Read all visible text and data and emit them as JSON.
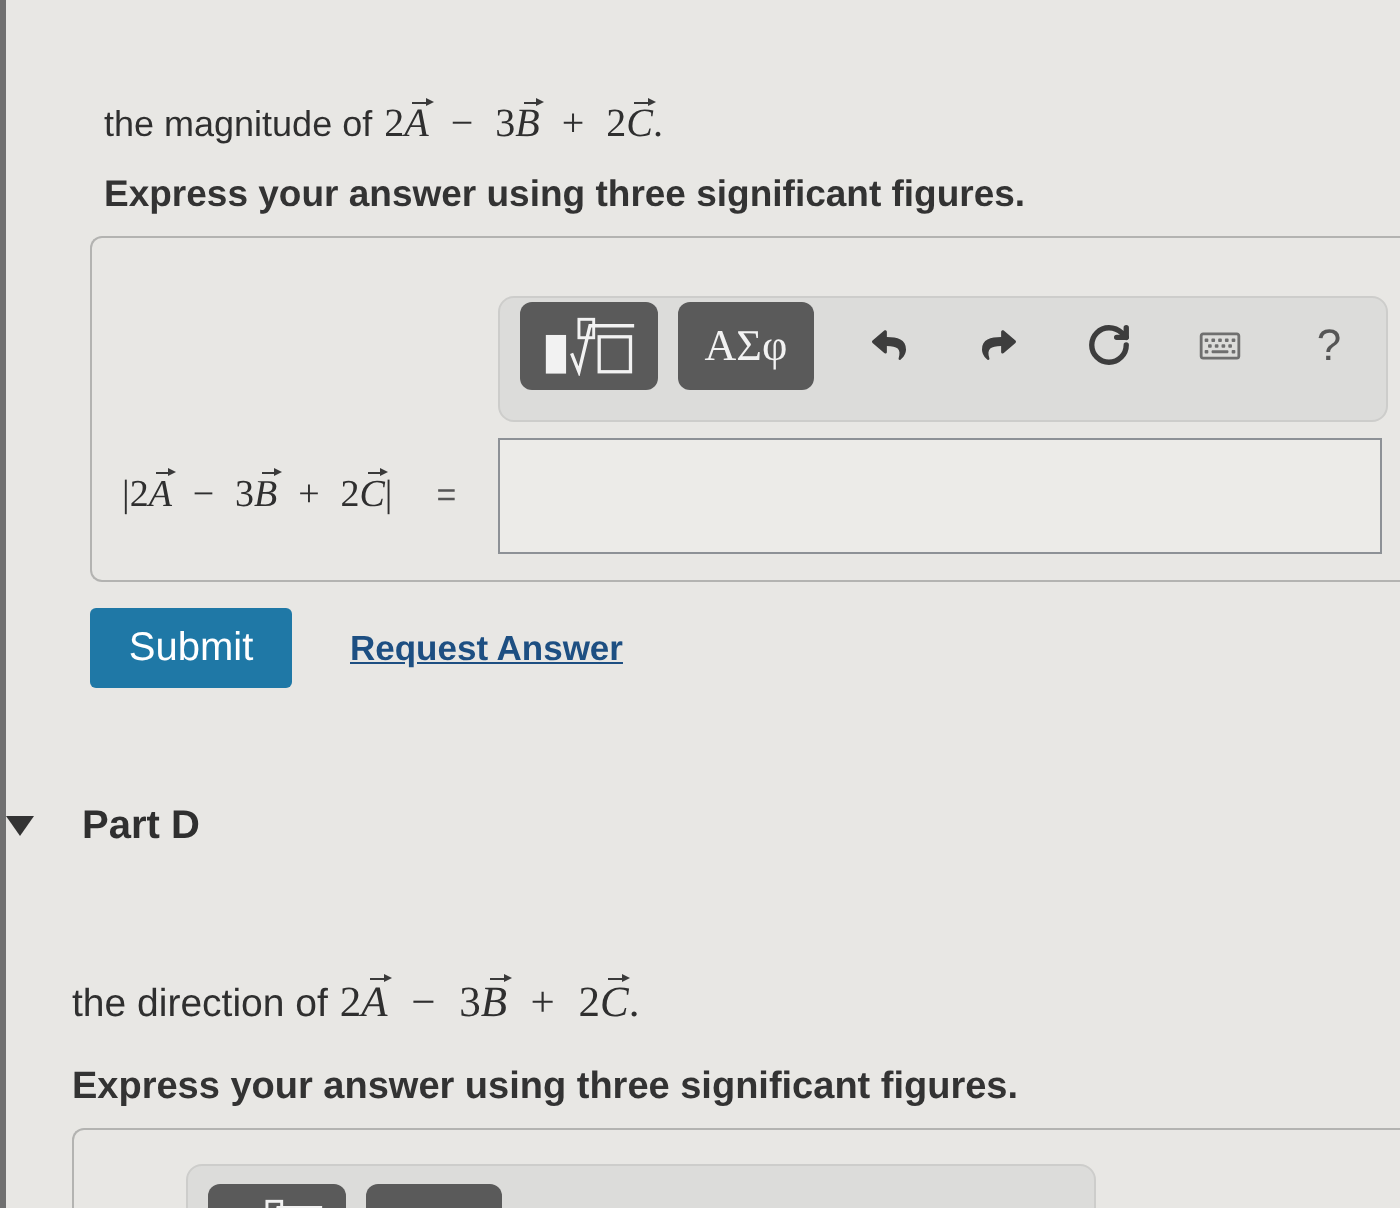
{
  "part_c": {
    "question": {
      "text": "the magnitude of",
      "math": [
        {
          "kind": "number",
          "text": "2"
        },
        {
          "kind": "vector",
          "text": "A"
        },
        {
          "kind": "operator",
          "text": "−"
        },
        {
          "kind": "number",
          "text": "3"
        },
        {
          "kind": "vector",
          "text": "B"
        },
        {
          "kind": "operator",
          "text": "+"
        },
        {
          "kind": "number",
          "text": "2"
        },
        {
          "kind": "vector",
          "text": "C"
        },
        {
          "kind": "punctuation",
          "text": "."
        }
      ]
    },
    "instruction": "Express your answer using three significant figures.",
    "toolbar": [
      {
        "kind": "templates"
      },
      {
        "kind": "symbols",
        "label": "ΑΣφ"
      },
      {
        "kind": "undo"
      },
      {
        "kind": "redo"
      },
      {
        "kind": "reset"
      },
      {
        "kind": "keyboard"
      },
      {
        "kind": "help",
        "label": "?"
      }
    ],
    "answer": {
      "math": [
        {
          "kind": "bar",
          "text": "|"
        },
        {
          "kind": "number",
          "text": "2"
        },
        {
          "kind": "vector",
          "text": "A"
        },
        {
          "kind": "operator",
          "text": "−"
        },
        {
          "kind": "number",
          "text": "3"
        },
        {
          "kind": "vector",
          "text": "B"
        },
        {
          "kind": "operator",
          "text": "+"
        },
        {
          "kind": "number",
          "text": "2"
        },
        {
          "kind": "vector",
          "text": "C"
        },
        {
          "kind": "bar",
          "text": "|"
        }
      ],
      "sign": "="
    },
    "actions": [
      {
        "kind": "submit",
        "label": "Submit"
      },
      {
        "kind": "link",
        "label": "Request Answer"
      }
    ]
  },
  "part_d": {
    "title": "Part D",
    "expanded": true,
    "question": {
      "text": "the direction of",
      "math": [
        {
          "kind": "number",
          "text": "2"
        },
        {
          "kind": "vector",
          "text": "A"
        },
        {
          "kind": "operator",
          "text": "−"
        },
        {
          "kind": "number",
          "text": "3"
        },
        {
          "kind": "vector",
          "text": "B"
        },
        {
          "kind": "operator",
          "text": "+"
        },
        {
          "kind": "number",
          "text": "2"
        },
        {
          "kind": "vector",
          "text": "C"
        },
        {
          "kind": "punctuation",
          "text": "."
        }
      ]
    },
    "instruction": "Express your answer using three significant figures.",
    "toolbar": [
      {
        "kind": "templates"
      },
      {
        "kind": "symbols"
      }
    ]
  }
}
